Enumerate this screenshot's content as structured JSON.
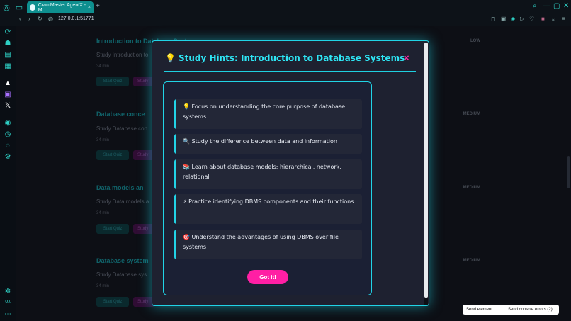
{
  "browser": {
    "tab_title": "CramMaster AgentX - M...",
    "url": "127.0.0.1:51771",
    "new_tab": "+",
    "close_tab": "×"
  },
  "sidebar_icons": [
    "refresh-icon",
    "bot-icon",
    "layers-icon",
    "file-icon",
    "logo-icon",
    "twitch-icon",
    "x-icon",
    "play-icon",
    "clock-icon",
    "chat-icon",
    "gear-icon",
    "flower-icon",
    "ox-icon",
    "more-icon"
  ],
  "background_cards": [
    {
      "title": "Introduction to Database Systems",
      "desc": "Study Introduction to",
      "meta_time": "34 min",
      "meta_q": "3 questi",
      "start": "Start Quiz",
      "study": "Study",
      "level": "LOW"
    },
    {
      "title": "Database conce",
      "desc": "Study Database con",
      "meta_time": "34 min",
      "meta_q": "3 questi",
      "start": "Start Quiz",
      "study": "Study",
      "level": "MEDIUM"
    },
    {
      "title": "Data models an",
      "desc": "Study Data models a",
      "meta_time": "34 min",
      "meta_q": "3 questi",
      "start": "Start Quiz",
      "study": "Study",
      "level": "MEDIUM"
    },
    {
      "title": "Database system",
      "desc": "Study Database sys",
      "meta_time": "34 min",
      "meta_q": "3 questi",
      "start": "Start Quiz",
      "study": "Study",
      "level": "MEDIUM"
    }
  ],
  "modal": {
    "title": "Study Hints: Introduction to Database Systems",
    "close": "×",
    "hints": [
      "💡 Focus on understanding the core purpose of database systems",
      "🔍 Study the difference between data and information",
      "📚 Learn about database models: hierarchical, network, relational",
      "⚡ Practice identifying DBMS components and their functions",
      "🎯 Understand the advantages of using DBMS over file systems"
    ],
    "button": "Got it!"
  },
  "devtools": {
    "send_element": "Send element",
    "send_console": "Send console errors (2)"
  },
  "colors": {
    "accent": "#21d4e6",
    "pink": "#ff1fa4",
    "modal_bg": "#1e2130"
  }
}
